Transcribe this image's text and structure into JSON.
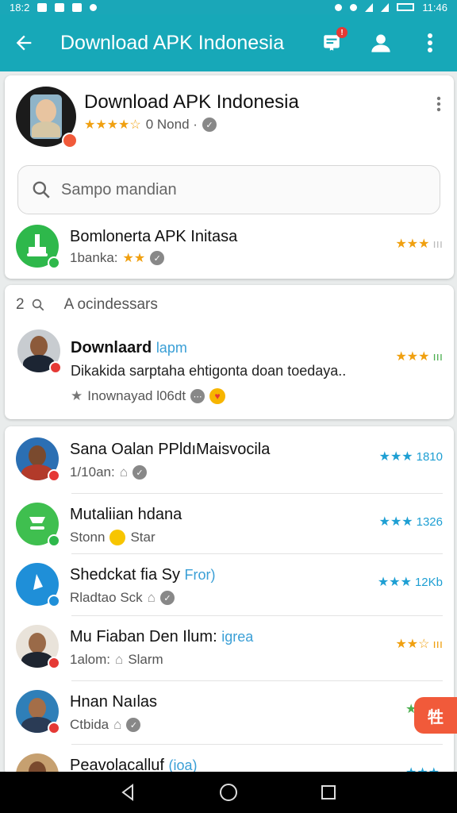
{
  "status_bar": {
    "time_left": "18:2",
    "time_right": "11:46"
  },
  "app_bar": {
    "title": "Download APK Indonesia",
    "notification_count": "!"
  },
  "header_card": {
    "title": "Download APK Indonesia",
    "rating_stars": "★★★★☆",
    "meta": "0 Nond ·"
  },
  "search": {
    "placeholder": "Sampo mandian"
  },
  "featured": {
    "title": "Bomlonerta APK Initasa",
    "sub": "1banka:",
    "sub_stars": "★★",
    "right_stars": "★★★",
    "right_text": "ııı"
  },
  "section2": {
    "count": "2",
    "label": "A ocindessars",
    "item": {
      "title": "Downlaard",
      "tag": "lapm",
      "desc": "Dikakida sarptaha ehtigonta doan toedaya..",
      "meta": "Inownayad l06dt",
      "right_stars": "★★★",
      "right_text": "ııı"
    }
  },
  "list": [
    {
      "title": "Sana Oalan PPldıMaisvocila",
      "tag": "",
      "sub": "1/10an:",
      "right_stars": "★★★",
      "right_text": "1810",
      "right_color": "#1e9fd3"
    },
    {
      "title": "Mutaliian hdana",
      "tag": "",
      "sub": "Stonn",
      "sub2": "Star",
      "right_stars": "★★★",
      "right_text": "1326",
      "right_color": "#1e9fd3"
    },
    {
      "title": "Shedckat fia Sy",
      "tag": "Fror)",
      "sub": "Rladtao Sck",
      "right_stars": "★★★",
      "right_text": "12Kb",
      "right_color": "#1e9fd3"
    },
    {
      "title": "Mu Fiaban Den Ilum:",
      "tag": "igrea",
      "sub": "1alom:",
      "sub2": "Slarm",
      "right_stars": "★★☆",
      "right_text": "ııı",
      "right_color": "#f0a010"
    },
    {
      "title": "Hnan Naılas",
      "tag": "",
      "sub": "Ctbida",
      "right_stars": "★★★",
      "right_text": "",
      "right_color": "#4caf50"
    },
    {
      "title": "Peavolacalluf",
      "tag": "(ioa)",
      "sub": "",
      "right_stars": "★★★",
      "right_text": "",
      "right_color": "#1e9fd3"
    }
  ],
  "fab": {
    "label": "牲"
  },
  "colors": {
    "primary": "#17a8b8",
    "accent": "#f15a3a",
    "star_gold": "#f0a010",
    "star_blue": "#1e9fd3"
  }
}
